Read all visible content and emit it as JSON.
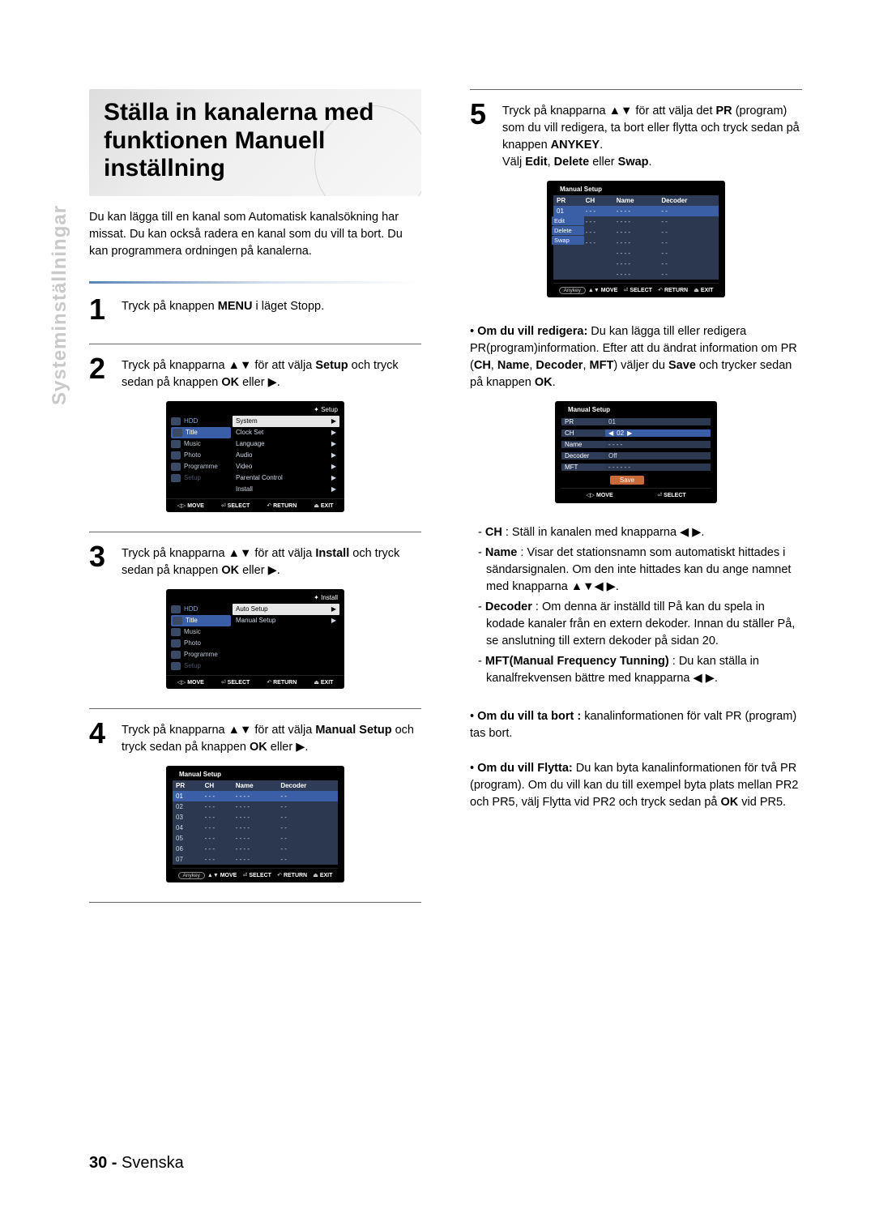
{
  "title": "Ställa in kanalerna med funktionen Manuell inställning",
  "side_label": "Systeminställningar",
  "intro": "Du kan lägga till en kanal som Automatisk kanalsökning har missat. Du kan också radera en kanal som du vill ta bort. Du kan programmera ordningen på kanalerna.",
  "footer_page": "30 -",
  "footer_lang": "Svenska",
  "steps": {
    "s1": {
      "num": "1",
      "text_a": "Tryck på knappen ",
      "b1": "MENU",
      "text_b": " i läget Stopp."
    },
    "s2": {
      "num": "2",
      "text_a": "Tryck på knapparna ▲▼ för att välja ",
      "b1": "Setup",
      "text_b": " och tryck sedan på knappen ",
      "b2": "OK",
      "text_c": " eller ▶."
    },
    "s3": {
      "num": "3",
      "text_a": "Tryck på knapparna ▲▼ för att välja ",
      "b1": "Install",
      "text_b": " och tryck sedan på knappen ",
      "b2": "OK",
      "text_c": " eller ▶."
    },
    "s4": {
      "num": "4",
      "text_a": "Tryck på knapparna ▲▼ för att välja ",
      "b1": "Manual Setup",
      "text_b": " och tryck sedan på knappen ",
      "b2": "OK",
      "text_c": " eller ▶."
    },
    "s5": {
      "num": "5",
      "text_a": "Tryck på knapparna ▲▼ för att välja det ",
      "b1": "PR",
      "text_b": " (program) som du vill redigera, ta bort eller flytta och tryck sedan på knappen ",
      "b2": "ANYKEY",
      "text_c": ".",
      "line2_a": "Välj ",
      "line2_b1": "Edit",
      "line2_b2": "Delete",
      "line2_or": " eller ",
      "line2_b3": "Swap",
      "line2_end": "."
    }
  },
  "right": {
    "edit_hdr_a": "Om du vill redigera:",
    "edit_txt_a": " Du kan lägga till eller redigera PR(program)information. Efter att du ändrat information om PR (",
    "edit_b1": "CH",
    "edit_b2": "Name",
    "edit_b3": "Decoder",
    "edit_b4": "MFT",
    "edit_txt_b": ") väljer du ",
    "edit_b5": "Save",
    "edit_txt_c": " och trycker sedan på knappen ",
    "edit_b6": "OK",
    "edit_txt_d": ".",
    "ch_label": "CH",
    "ch_text": " : Ställ in kanalen med knapparna ◀ ▶.",
    "name_label": "Name",
    "name_text": " : Visar det stationsnamn som automatiskt hittades i sändarsignalen. Om den inte hittades kan du ange namnet med knapparna ▲▼◀ ▶.",
    "dec_label": "Decoder",
    "dec_text": " : Om denna är inställd till På kan du spela in kodade kanaler från en extern dekoder. Innan du ställer På, se anslutning till extern dekoder på sidan 20.",
    "mft_label": "MFT(Manual Frequency Tunning)",
    "mft_text": " : Du kan ställa in kanalfrekvensen bättre med knapparna ◀ ▶.",
    "del_label": "Om du vill ta bort :",
    "del_text": " kanalinformationen för valt PR (program) tas bort.",
    "move_label": "Om du vill Flytta:",
    "move_text": " Du kan byta kanalinformationen för två PR (program). Om du vill kan du till exempel byta plats mellan PR2 och PR5, välj Flytta vid PR2 och tryck sedan på ",
    "move_b": "OK",
    "move_text2": " vid PR5."
  },
  "osd": {
    "crumb_setup": "Setup",
    "crumb_install": "Install",
    "sidebar": {
      "hdd": "HDD",
      "title": "Title",
      "music": "Music",
      "photo": "Photo",
      "programme": "Programme",
      "setup": "Setup"
    },
    "setup_menu": [
      "System",
      "Clock Set",
      "Language",
      "Audio",
      "Video",
      "Parental Control",
      "Install"
    ],
    "install_menu": [
      "Auto Setup",
      "Manual Setup"
    ],
    "ms_title": "Manual Setup",
    "ms_headers": {
      "pr": "PR",
      "ch": "CH",
      "name": "Name",
      "decoder": "Decoder"
    },
    "ms_rows7": [
      "01",
      "02",
      "03",
      "04",
      "05",
      "06",
      "07"
    ],
    "ms_rows4": [
      "01",
      "02",
      "03",
      "04"
    ],
    "placeholder3": "- - -",
    "placeholder4": "- - - -",
    "placeholder2": "- -",
    "over_menu": {
      "edit": "Edit",
      "delete": "Delete",
      "swap": "Swap"
    },
    "form": {
      "pr": "PR",
      "pr_v": "01",
      "ch": "CH",
      "ch_v": "02",
      "name": "Name",
      "name_v": "- - - -",
      "dec": "Decoder",
      "dec_v": "Off",
      "mft": "MFT",
      "mft_v": "- - -   - - -",
      "save": "Save"
    },
    "footer": {
      "move": "MOVE",
      "select": "SELECT",
      "return": "RETURN",
      "exit": "EXIT",
      "anykey": "Anykey"
    }
  }
}
